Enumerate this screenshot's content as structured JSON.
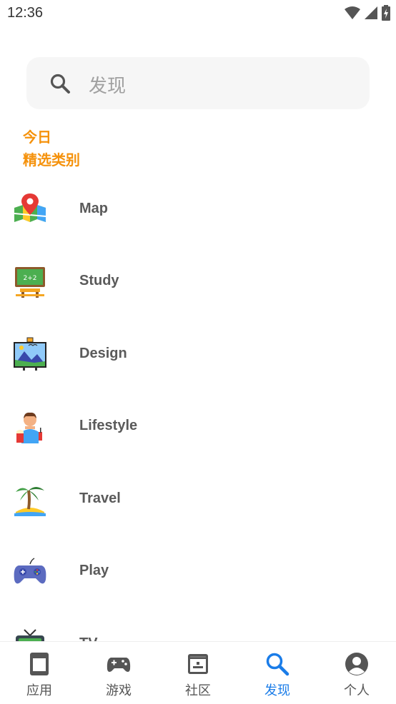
{
  "status_bar": {
    "time": "12:36"
  },
  "search": {
    "placeholder": "发现"
  },
  "section": {
    "title_line1": "今日",
    "title_line2": "精选类别"
  },
  "categories": [
    {
      "label": "Map",
      "icon": "map-pin-icon"
    },
    {
      "label": "Study",
      "icon": "chalkboard-icon"
    },
    {
      "label": "Design",
      "icon": "easel-painting-icon"
    },
    {
      "label": "Lifestyle",
      "icon": "person-popcorn-icon"
    },
    {
      "label": "Travel",
      "icon": "palm-tree-icon"
    },
    {
      "label": "Play",
      "icon": "gamepad-icon"
    },
    {
      "label": "TV",
      "icon": "tv-icon"
    }
  ],
  "bottom_nav": [
    {
      "label": "应用",
      "icon": "apps-icon"
    },
    {
      "label": "游戏",
      "icon": "gamepad-icon"
    },
    {
      "label": "社区",
      "icon": "community-icon"
    },
    {
      "label": "发现",
      "icon": "search-icon",
      "active": true
    },
    {
      "label": "个人",
      "icon": "profile-icon"
    }
  ],
  "colors": {
    "accent_orange": "#f5920c",
    "active_blue": "#1a7ce8"
  }
}
